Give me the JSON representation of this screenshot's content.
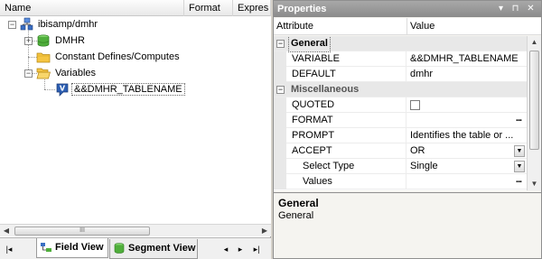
{
  "tree_panel": {
    "columns": [
      "Name",
      "Format",
      "Expres"
    ],
    "nodes": [
      {
        "label": "ibisamp/dmhr",
        "expander": "−"
      },
      {
        "label": "DMHR",
        "expander": "+"
      },
      {
        "label": "Constant Defines/Computes",
        "expander": ""
      },
      {
        "label": "Variables",
        "expander": "−"
      },
      {
        "label": "&&DMHR_TABLENAME",
        "expander": ""
      }
    ],
    "scroll_grip": "III",
    "tabs": [
      {
        "label": "Field View",
        "active": true
      },
      {
        "label": "Segment View",
        "active": false
      }
    ],
    "nav_arrows": [
      "◂",
      "◂",
      "▸",
      "▸▸"
    ]
  },
  "properties_panel": {
    "title": "Properties",
    "title_buttons": [
      "▾",
      "▫",
      "✕"
    ],
    "header": {
      "attribute": "Attribute",
      "value": "Value"
    },
    "rows": [
      {
        "kind": "category",
        "name": "General",
        "sign": "−"
      },
      {
        "kind": "prop",
        "name": "VARIABLE",
        "value": "&&DMHR_TABLENAME",
        "editor": ""
      },
      {
        "kind": "prop",
        "name": "DEFAULT",
        "value": "dmhr",
        "editor": ""
      },
      {
        "kind": "category",
        "name": "Miscellaneous",
        "sign": "−"
      },
      {
        "kind": "prop",
        "name": "QUOTED",
        "value": "",
        "editor": "checkbox",
        "checked": false
      },
      {
        "kind": "prop",
        "name": "FORMAT",
        "value": "",
        "editor": "ellipsis"
      },
      {
        "kind": "prop",
        "name": "PROMPT",
        "value": "Identifies the table or ...",
        "editor": ""
      },
      {
        "kind": "prop",
        "name": "ACCEPT",
        "value": "OR",
        "editor": "dropdown"
      },
      {
        "kind": "prop",
        "name": "Select Type",
        "value": "Single",
        "editor": "dropdown",
        "sub": true
      },
      {
        "kind": "prop",
        "name": "Values",
        "value": "",
        "editor": "ellipsis",
        "sub": true
      }
    ],
    "ellipsis_text": "...",
    "description": {
      "title": "General",
      "text": "General"
    }
  }
}
